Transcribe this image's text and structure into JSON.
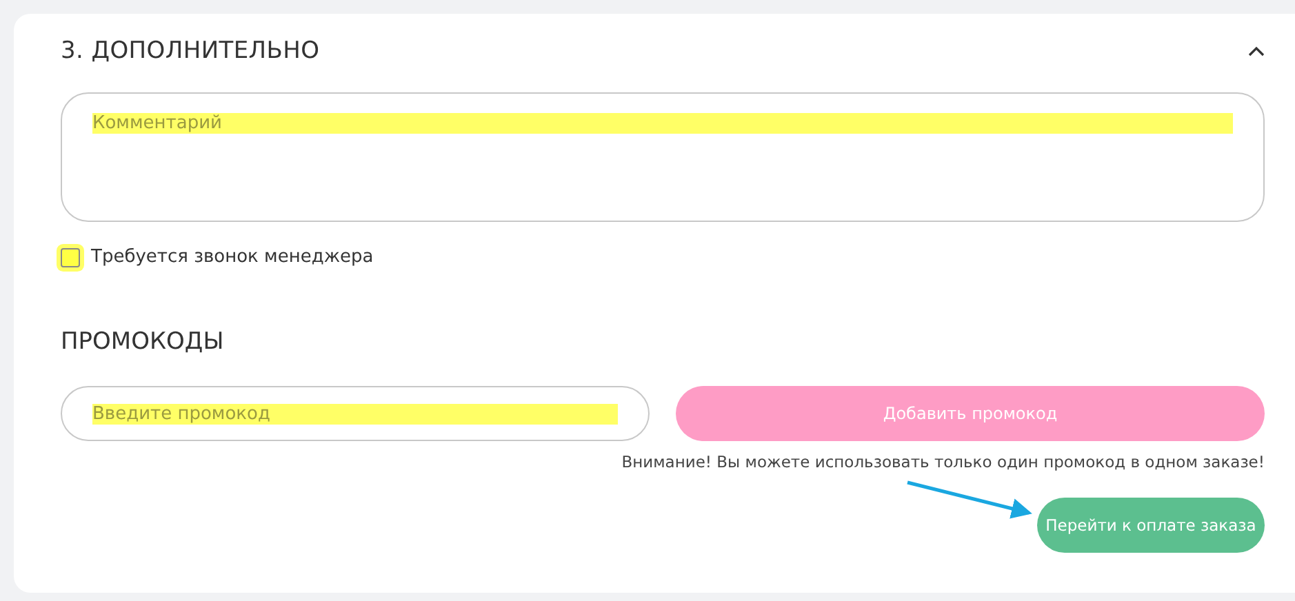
{
  "section": {
    "title": "3. ДОПОЛНИТЕЛЬНО",
    "expanded": true
  },
  "comment": {
    "placeholder": "Комментарий"
  },
  "manager_call": {
    "label": "Требуется звонок менеджера",
    "checked": false
  },
  "promo": {
    "title": "ПРОМОКОДЫ",
    "placeholder": "Введите промокод",
    "button": "Добавить промокод",
    "note": "Внимание! Вы можете использовать только один промокод в одном заказе!"
  },
  "checkout_button": "Перейти к оплате заказа"
}
